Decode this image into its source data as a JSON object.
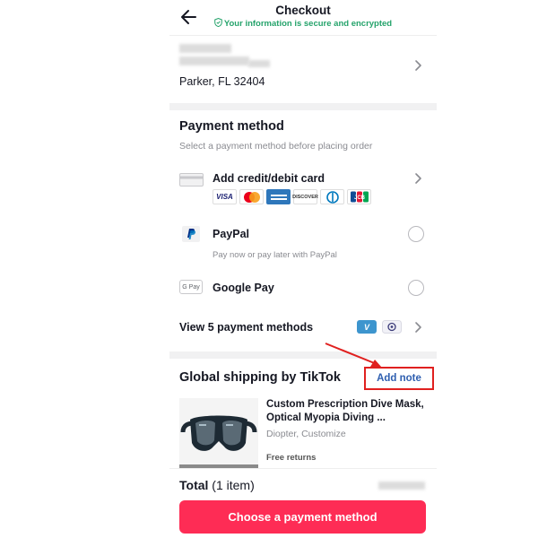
{
  "header": {
    "title": "Checkout",
    "secure_text": "Your information is secure and encrypted"
  },
  "address": {
    "city_line": "Parker, FL 32404"
  },
  "payment": {
    "title": "Payment method",
    "subtitle": "Select a payment method before placing order",
    "card": {
      "label": "Add credit/debit card",
      "logos": [
        "VISA",
        "Mastercard",
        "AMERICAN EXPRESS",
        "DISCOVER",
        "Diners Club",
        "JCB"
      ],
      "visa_text": "VISA",
      "discover_text": "DISCOVER",
      "jcb_text": "JCB"
    },
    "paypal": {
      "label": "PayPal",
      "sub": "Pay now or pay later with PayPal",
      "selected": false
    },
    "googlepay": {
      "label": "Google Pay",
      "icon_text": "G Pay",
      "selected": false
    },
    "more": {
      "label": "View 5 payment methods",
      "icons": [
        "venmo-icon",
        "afterpay-icon"
      ],
      "venmo_text": "V"
    }
  },
  "shipping": {
    "title": "Global shipping by TikTok",
    "add_note": "Add note"
  },
  "product": {
    "title": "Custom Prescription Dive Mask, Optical Myopia Diving ...",
    "variant": "Diopter, Customize",
    "returns": "Free returns"
  },
  "footer": {
    "total_label": "Total",
    "total_items": "(1 item)",
    "cta": "Choose a payment method"
  },
  "colors": {
    "accent": "#fe2c55",
    "secure_green": "#25a36b",
    "link_blue": "#2f5fb0",
    "annotation_red": "#e0201f"
  }
}
